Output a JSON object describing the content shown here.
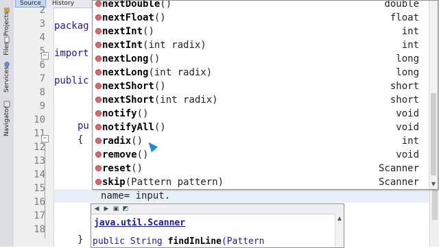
{
  "toolbar": {
    "tabs": [
      "Source",
      "History"
    ]
  },
  "side_tabs": [
    "Projects",
    "Files",
    "Services",
    "Navigator"
  ],
  "line_numbers": [
    "2",
    "3",
    "4",
    "5",
    "6",
    "7",
    "8",
    "9",
    "10",
    "11",
    "12",
    "13",
    "14",
    "15",
    "16",
    "17",
    "18"
  ],
  "code": {
    "l3_kw": "packag",
    "l5_kw": "import",
    "l7_kw": "public",
    "l10_kw": "pu",
    "l11": "{",
    "l15": "name= input.",
    "l18": "}"
  },
  "completion": {
    "items": [
      {
        "name": "nextDouble",
        "params": "()",
        "ret": "double"
      },
      {
        "name": "nextFloat",
        "params": "()",
        "ret": "float"
      },
      {
        "name": "nextInt",
        "params": "()",
        "ret": "int"
      },
      {
        "name": "nextInt",
        "params": "(int radix)",
        "ret": "int"
      },
      {
        "name": "nextLong",
        "params": "()",
        "ret": "long"
      },
      {
        "name": "nextLong",
        "params": "(int radix)",
        "ret": "long"
      },
      {
        "name": "nextShort",
        "params": "()",
        "ret": "short"
      },
      {
        "name": "nextShort",
        "params": "(int radix)",
        "ret": "short"
      },
      {
        "name": "notify",
        "params": "()",
        "ret": "void"
      },
      {
        "name": "notifyAll",
        "params": "()",
        "ret": "void"
      },
      {
        "name": "radix",
        "params": "()",
        "ret": "int"
      },
      {
        "name": "remove",
        "params": "()",
        "ret": "void"
      },
      {
        "name": "reset",
        "params": "()",
        "ret": "Scanner"
      },
      {
        "name": "skip",
        "params": "(Pattern pattern)",
        "ret": "Scanner"
      }
    ]
  },
  "javadoc": {
    "class_link": "java.util.Scanner",
    "sig_prefix": "public",
    "sig_type": "String",
    "sig_name": "findInLine",
    "sig_param": "(Pattern"
  },
  "colors": {
    "method_dot": "#e0676b",
    "keyword": "#1a1aa6",
    "cursor": "#1e88e5"
  }
}
